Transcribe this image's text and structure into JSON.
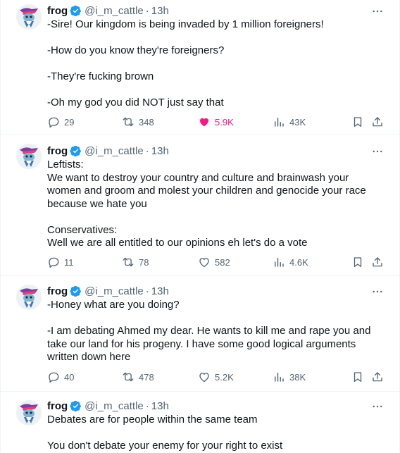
{
  "colors": {
    "verified": "#1d9bf0",
    "like_active": "#f91880",
    "muted": "#536471",
    "text": "#0f1419"
  },
  "icons": [
    "verified-badge-icon",
    "more-icon",
    "reply-icon",
    "retweet-icon",
    "like-icon",
    "views-icon",
    "bookmark-icon",
    "share-icon"
  ],
  "tweets": [
    {
      "author": {
        "name": "frog",
        "handle": "@i_m_cattle",
        "time": "13h",
        "verified": true
      },
      "paragraphs": [
        "-Sire! Our kingdom is being invaded by 1 million foreigners!",
        "-How do you know they're foreigners?",
        "-They're fucking brown",
        "-Oh my god you did NOT just say that"
      ],
      "stats": {
        "replies": "29",
        "retweets": "348",
        "likes": "5.9K",
        "views": "43K",
        "liked": true
      }
    },
    {
      "author": {
        "name": "frog",
        "handle": "@i_m_cattle",
        "time": "13h",
        "verified": true
      },
      "paragraphs": [
        "Leftists:\nWe want to destroy your country and culture and brainwash your women and groom and molest your children and genocide your race because we hate you",
        "Conservatives:\nWell we are all entitled to our opinions eh let's do a vote"
      ],
      "stats": {
        "replies": "11",
        "retweets": "78",
        "likes": "582",
        "views": "4.6K",
        "liked": false
      }
    },
    {
      "author": {
        "name": "frog",
        "handle": "@i_m_cattle",
        "time": "13h",
        "verified": true
      },
      "paragraphs": [
        "-Honey what are you doing?",
        "-I am debating Ahmed my dear. He wants to kill me and rape you and take our land for his progeny. I have some good logical arguments written down here"
      ],
      "stats": {
        "replies": "40",
        "retweets": "478",
        "likes": "5.2K",
        "views": "38K",
        "liked": false
      }
    },
    {
      "author": {
        "name": "frog",
        "handle": "@i_m_cattle",
        "time": "13h",
        "verified": true
      },
      "paragraphs": [
        "Debates are for people within the same team",
        "You don't debate your enemy for your right to exist"
      ]
    }
  ]
}
